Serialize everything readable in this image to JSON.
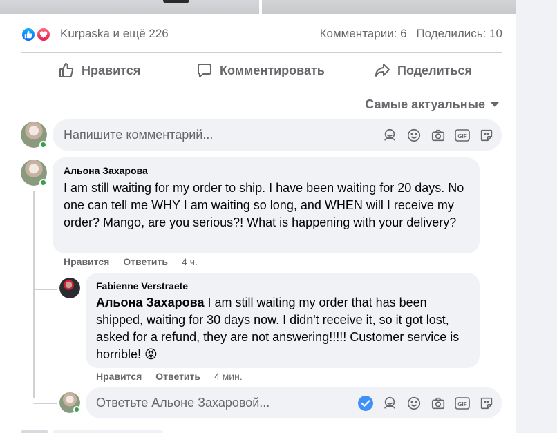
{
  "post": {
    "reactions": {
      "names": "Kurpaska и ещё 226",
      "comments": "Комментарии: 6",
      "shares": "Поделились: 10"
    },
    "actions": {
      "like": "Нравится",
      "comment": "Комментировать",
      "share": "Поделиться"
    },
    "sort_label": "Самые актуальные"
  },
  "composer": {
    "placeholder": "Напишите комментарий..."
  },
  "comments": [
    {
      "author": "Альона Захарова",
      "text": "I am still waiting for my order to ship. I have been waiting for 20 days. No one can tell me WHY I am waiting so long, and WHEN will I receive my order? Mango, are you serious?! What is happening with your delivery?",
      "like": "Нравится",
      "reply": "Ответить",
      "time": "4 ч."
    }
  ],
  "replies": [
    {
      "author": "Fabienne Verstraete",
      "mention": "Альона Захарова",
      "text": " I am still waiting my order that has been shipped, waiting for 30 days now. I didn't receive it, so it got lost, asked for a refund, they are not answering!!!!! Customer service is horrible! 😡",
      "like": "Нравится",
      "reply": "Ответить",
      "time": "4 мин."
    }
  ],
  "reply_composer": {
    "placeholder": "Ответьте Альоне Захаровой..."
  },
  "colors": {
    "accent": "#0866ff",
    "online": "#31a24c",
    "angry": "#f7714c"
  }
}
